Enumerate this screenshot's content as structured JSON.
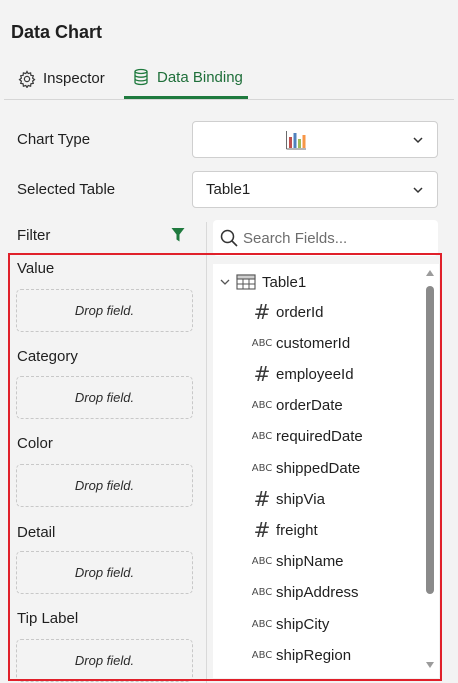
{
  "panel": {
    "title": "Data Chart"
  },
  "tabs": [
    {
      "label": "Inspector",
      "icon": "gear-icon",
      "active": false
    },
    {
      "label": "Data Binding",
      "icon": "database-icon",
      "active": true
    }
  ],
  "settings": {
    "chart_type_label": "Chart Type",
    "chart_type_icon": "bar-chart-icon",
    "selected_table_label": "Selected Table",
    "selected_table_value": "Table1"
  },
  "filter": {
    "label": "Filter",
    "icon": "filter-icon"
  },
  "search": {
    "placeholder": "Search Fields..."
  },
  "slots": [
    {
      "label": "Value",
      "drop_text": "Drop field."
    },
    {
      "label": "Category",
      "drop_text": "Drop field."
    },
    {
      "label": "Color",
      "drop_text": "Drop field."
    },
    {
      "label": "Detail",
      "drop_text": "Drop field."
    },
    {
      "label": "Tip Label",
      "drop_text": "Drop field."
    }
  ],
  "tree": {
    "table_name": "Table1",
    "fields": [
      {
        "name": "orderId",
        "type": "number",
        "type_glyph": "#"
      },
      {
        "name": "customerId",
        "type": "string",
        "type_glyph": "ABC"
      },
      {
        "name": "employeeId",
        "type": "number",
        "type_glyph": "#"
      },
      {
        "name": "orderDate",
        "type": "string",
        "type_glyph": "ABC"
      },
      {
        "name": "requiredDate",
        "type": "string",
        "type_glyph": "ABC"
      },
      {
        "name": "shippedDate",
        "type": "string",
        "type_glyph": "ABC"
      },
      {
        "name": "shipVia",
        "type": "number",
        "type_glyph": "#"
      },
      {
        "name": "freight",
        "type": "number",
        "type_glyph": "#"
      },
      {
        "name": "shipName",
        "type": "string",
        "type_glyph": "ABC"
      },
      {
        "name": "shipAddress",
        "type": "string",
        "type_glyph": "ABC"
      },
      {
        "name": "shipCity",
        "type": "string",
        "type_glyph": "ABC"
      },
      {
        "name": "shipRegion",
        "type": "string",
        "type_glyph": "ABC"
      }
    ]
  },
  "colors": {
    "accent": "#1f7a3e",
    "highlight": "#e0202a"
  }
}
